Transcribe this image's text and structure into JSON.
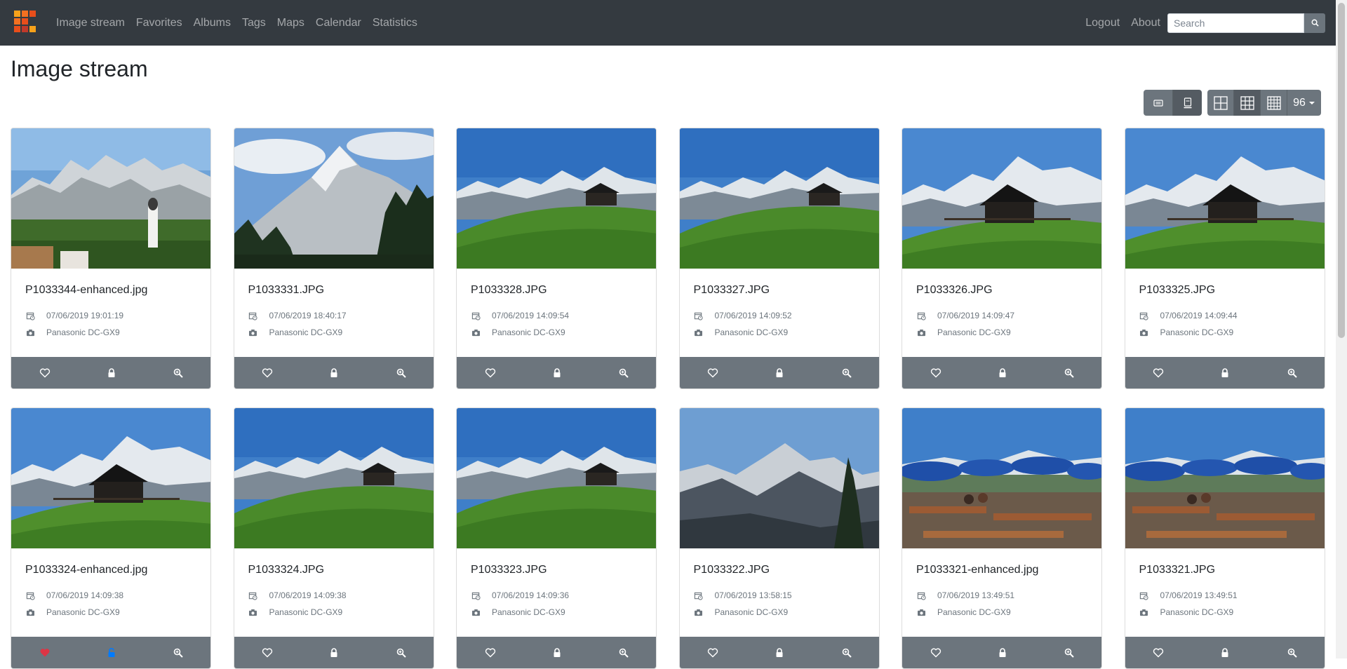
{
  "nav": {
    "links": [
      "Image stream",
      "Favorites",
      "Albums",
      "Tags",
      "Maps",
      "Calendar",
      "Statistics"
    ],
    "right_links": [
      "Logout",
      "About"
    ],
    "search_placeholder": "Search"
  },
  "page": {
    "title": "Image stream"
  },
  "toolbar": {
    "view_buttons": [
      "list-view-icon",
      "card-view-icon"
    ],
    "grid_buttons": [
      "grid-2x2-icon",
      "grid-3x3-icon",
      "grid-4x4-icon"
    ],
    "page_size": "96"
  },
  "colors": {
    "navbar": "#343a40",
    "secondary": "#6c757d",
    "favorite": "#dc3545",
    "public": "#007bff"
  },
  "images": [
    {
      "filename": "P1033344-enhanced.jpg",
      "date": "07/06/2019 19:01:19",
      "camera": "Panasonic DC-GX9",
      "favorite": false,
      "public": false,
      "scene": "village-mountains"
    },
    {
      "filename": "P1033331.JPG",
      "date": "07/06/2019 18:40:17",
      "camera": "Panasonic DC-GX9",
      "favorite": false,
      "public": false,
      "scene": "peak-forest"
    },
    {
      "filename": "P1033328.JPG",
      "date": "07/06/2019 14:09:54",
      "camera": "Panasonic DC-GX9",
      "favorite": false,
      "public": false,
      "scene": "hut-meadow"
    },
    {
      "filename": "P1033327.JPG",
      "date": "07/06/2019 14:09:52",
      "camera": "Panasonic DC-GX9",
      "favorite": false,
      "public": false,
      "scene": "hut-meadow"
    },
    {
      "filename": "P1033326.JPG",
      "date": "07/06/2019 14:09:47",
      "camera": "Panasonic DC-GX9",
      "favorite": false,
      "public": false,
      "scene": "hut-meadow-close"
    },
    {
      "filename": "P1033325.JPG",
      "date": "07/06/2019 14:09:44",
      "camera": "Panasonic DC-GX9",
      "favorite": false,
      "public": false,
      "scene": "hut-meadow-close"
    },
    {
      "filename": "P1033324-enhanced.jpg",
      "date": "07/06/2019 14:09:38",
      "camera": "Panasonic DC-GX9",
      "favorite": true,
      "public": true,
      "scene": "hut-meadow-close"
    },
    {
      "filename": "P1033324.JPG",
      "date": "07/06/2019 14:09:38",
      "camera": "Panasonic DC-GX9",
      "favorite": false,
      "public": false,
      "scene": "hut-meadow"
    },
    {
      "filename": "P1033323.JPG",
      "date": "07/06/2019 14:09:36",
      "camera": "Panasonic DC-GX9",
      "favorite": false,
      "public": false,
      "scene": "hut-meadow"
    },
    {
      "filename": "P1033322.JPG",
      "date": "07/06/2019 13:58:15",
      "camera": "Panasonic DC-GX9",
      "favorite": false,
      "public": false,
      "scene": "valley-tree"
    },
    {
      "filename": "P1033321-enhanced.jpg",
      "date": "07/06/2019 13:49:51",
      "camera": "Panasonic DC-GX9",
      "favorite": false,
      "public": false,
      "scene": "terrace"
    },
    {
      "filename": "P1033321.JPG",
      "date": "07/06/2019 13:49:51",
      "camera": "Panasonic DC-GX9",
      "favorite": false,
      "public": false,
      "scene": "terrace"
    }
  ]
}
